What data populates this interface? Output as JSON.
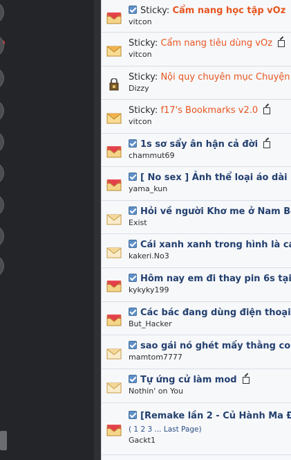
{
  "threads": [
    {
      "kind": "sticky",
      "checked": true,
      "prefix": "Sticky:",
      "title": "Cẩm nang học tập vOz",
      "author": "vitcon",
      "icon": "envelope-red-icon",
      "ext": false
    },
    {
      "kind": "sticky",
      "checked": false,
      "prefix": "Sticky:",
      "title": "Cẩm nang tiêu dùng vOz",
      "author": "vitcon",
      "icon": "envelope-orange-icon",
      "ext": true
    },
    {
      "kind": "sticky",
      "checked": false,
      "prefix": "Sticky:",
      "title": "Nội quy chuyên mục Chuyện",
      "author": "Dizzy",
      "icon": "lock-icon",
      "ext": false
    },
    {
      "kind": "sticky",
      "checked": false,
      "prefix": "Sticky:",
      "title": "f17's Bookmarks v2.0",
      "author": "vitcon",
      "icon": "envelope-orange-icon",
      "ext": true
    },
    {
      "kind": "thread",
      "checked": true,
      "title": "1s sơ sẩy ân hận cả đời",
      "author": "chammut69",
      "icon": "envelope-red-icon",
      "ext": true
    },
    {
      "kind": "thread",
      "checked": true,
      "title": "[ No sex ] Ảnh thể loại áo dài n",
      "author": "yama_kun",
      "icon": "envelope-red-icon",
      "ext": false
    },
    {
      "kind": "thread",
      "checked": true,
      "title": "Hỏi về người Khơ me ở Nam Bộ",
      "author": "Exist",
      "icon": "envelope-tan-icon",
      "ext": false
    },
    {
      "kind": "thread",
      "checked": true,
      "title": "Cái xanh xanh trong hình là cái",
      "author": "kakeri.No3",
      "icon": "envelope-tan-icon",
      "ext": false
    },
    {
      "kind": "thread",
      "checked": true,
      "title": "Hôm nay em đi thay pin 6s tại",
      "author": "kykyky199",
      "icon": "envelope-red-icon",
      "ext": false
    },
    {
      "kind": "thread",
      "checked": true,
      "title": "Các bác đang dùng điện thoại g",
      "author": "But_Hacker",
      "icon": "envelope-red-icon",
      "ext": false
    },
    {
      "kind": "thread",
      "checked": true,
      "title": "sao gái nó ghét mấy thằng con",
      "author": "mamtom7777",
      "icon": "envelope-tan-icon",
      "ext": false
    },
    {
      "kind": "thread",
      "checked": true,
      "title": "Tự ứng cử làm mod",
      "author": "Nothin' on You",
      "icon": "envelope-tan-icon",
      "ext": true
    },
    {
      "kind": "thread",
      "checked": true,
      "title": "[Remake lần 2 - Củ Hành Ma Đ",
      "author": "Gackt1",
      "icon": "envelope-red-icon",
      "ext": false,
      "pages": "( 1 2 3 ... Last Page)"
    }
  ],
  "colors": {
    "sticky_title": "#e6551f",
    "thread_title": "#23406f",
    "panel_bg": "#f7f8fa",
    "sidebar_bg": "#232529"
  }
}
